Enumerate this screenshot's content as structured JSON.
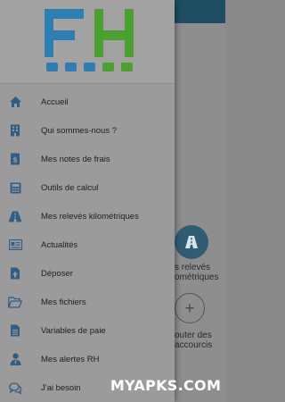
{
  "colors": {
    "drawer_bg": "#9b9b9b",
    "icon_blue": "#2f5f86",
    "logo_blue": "#2c7fb0",
    "logo_green": "#4aa12d",
    "text": "#1e1e1e"
  },
  "menu": {
    "items": [
      {
        "label": "Accueil",
        "icon": "home-icon"
      },
      {
        "label": "Qui sommes-nous ?",
        "icon": "building-icon"
      },
      {
        "label": "Mes notes de frais",
        "icon": "receipt-icon"
      },
      {
        "label": "Outils de calcul",
        "icon": "calculator-icon"
      },
      {
        "label": "Mes relevés kilométriques",
        "icon": "road-icon"
      },
      {
        "label": "Actualités",
        "icon": "newspaper-icon"
      },
      {
        "label": "Déposer",
        "icon": "upload-icon"
      },
      {
        "label": "Mes fichiers",
        "icon": "folder-open-icon"
      },
      {
        "label": "Variables de paie",
        "icon": "document-icon"
      },
      {
        "label": "Mes alertes RH",
        "icon": "user-tie-icon"
      },
      {
        "label": "J'ai besoin",
        "icon": "chat-icon"
      }
    ]
  },
  "background": {
    "tile_label_line1": "s relevés",
    "tile_label_line2": "ométriques",
    "add_label_line1": "outer des",
    "add_label_line2": "accourcis"
  },
  "watermark": "MYAPKS.COM"
}
